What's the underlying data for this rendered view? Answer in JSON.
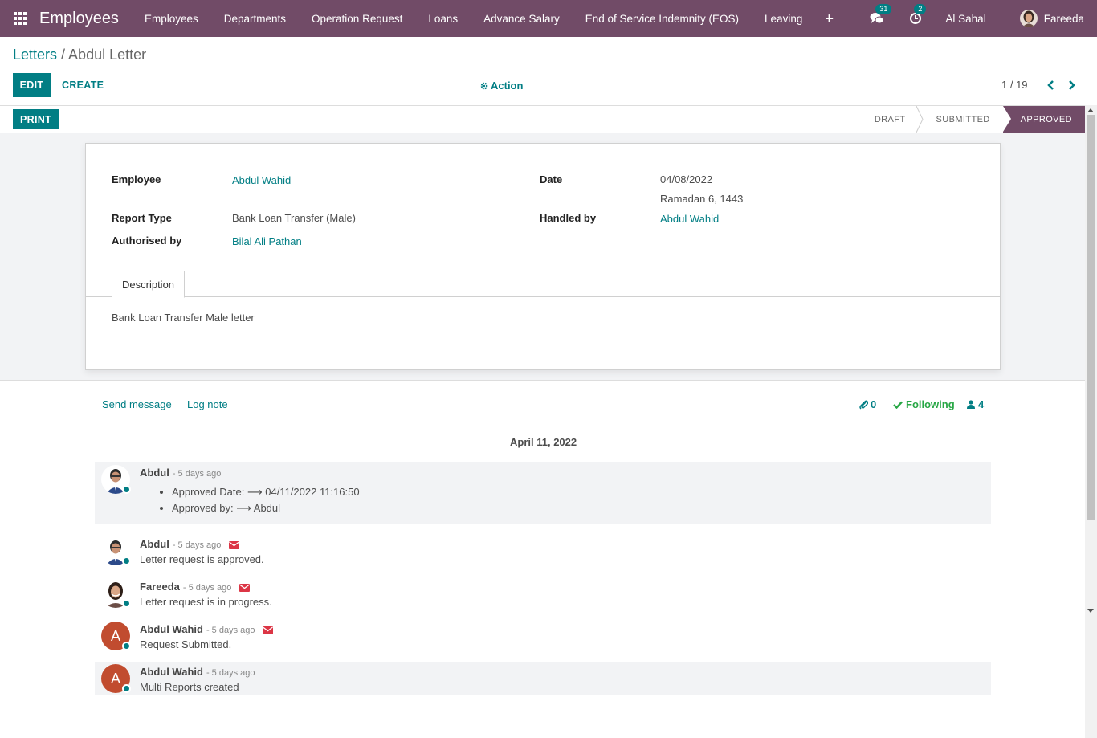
{
  "navbar": {
    "app_title": "Employees",
    "menu": [
      "Employees",
      "Departments",
      "Operation Request",
      "Loans",
      "Advance Salary",
      "End of Service Indemnity (EOS)",
      "Leaving"
    ],
    "plus": "+",
    "messages_badge": "31",
    "activities_badge": "2",
    "company": "Al Sahal",
    "user": "Fareeda"
  },
  "breadcrumb": {
    "parent": "Letters",
    "separator": " / ",
    "current": "Abdul Letter"
  },
  "toolbar": {
    "edit": "EDIT",
    "create": "CREATE",
    "action": "Action",
    "pager": "1 / 19"
  },
  "statusbar": {
    "print": "PRINT",
    "stages": [
      "DRAFT",
      "SUBMITTED",
      "APPROVED"
    ],
    "active_stage": "APPROVED"
  },
  "form": {
    "employee_label": "Employee",
    "employee_value": "Abdul Wahid",
    "report_type_label": "Report Type",
    "report_type_value": "Bank Loan Transfer (Male)",
    "authorised_label": "Authorised by",
    "authorised_value": "Bilal Ali Pathan",
    "date_label": "Date",
    "date_value": "04/08/2022",
    "hijri_date": "Ramadan 6, 1443",
    "handled_label": "Handled by",
    "handled_value": "Abdul Wahid",
    "tab_label": "Description",
    "description": "Bank Loan Transfer Male letter"
  },
  "chatter": {
    "send_message": "Send message",
    "log_note": "Log note",
    "attachments": "0",
    "following": "Following",
    "followers": "4",
    "date_separator": "April 11, 2022",
    "messages": [
      {
        "author": "Abdul",
        "time": "- 5 days ago",
        "tracking": [
          {
            "label": "Approved Date:",
            "arrow": "⟶",
            "value": "04/11/2022 11:16:50"
          },
          {
            "label": "Approved by:",
            "arrow": "⟶",
            "value": "Abdul"
          }
        ]
      },
      {
        "author": "Abdul",
        "time": "- 5 days ago",
        "body": "Letter request is approved."
      },
      {
        "author": "Fareeda",
        "time": "- 5 days ago",
        "body": "Letter request is in progress."
      },
      {
        "author": "Abdul Wahid",
        "initial": "A",
        "time": "- 5 days ago",
        "body": "Request Submitted."
      },
      {
        "author": "Abdul Wahid",
        "initial": "A",
        "time": "- 5 days ago",
        "body": "Multi Reports created"
      }
    ]
  },
  "colors": {
    "brand": "#714b67",
    "accent": "#017e84",
    "following": "#28a745",
    "mail": "#dc3545",
    "avatar_letter": "#c14c2f"
  }
}
